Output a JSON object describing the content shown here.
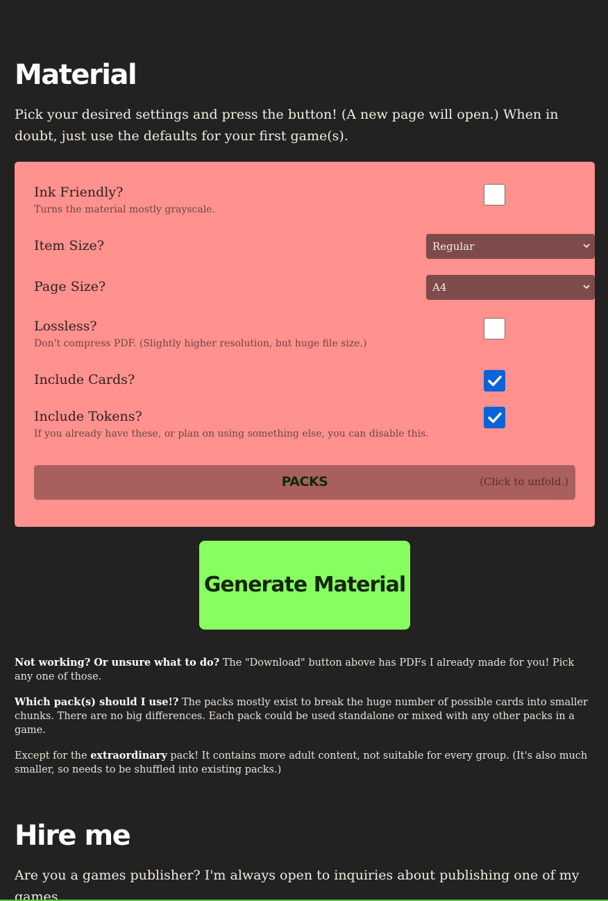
{
  "material": {
    "title": "Material",
    "intro": "Pick your desired settings and press the button! (A new page will open.) When in doubt, just use the defaults for your first game(s)."
  },
  "settings": {
    "ink_friendly": {
      "label": "Ink Friendly?",
      "desc": "Turns the material mostly grayscale.",
      "checked": false
    },
    "item_size": {
      "label": "Item Size?",
      "value": "Regular"
    },
    "page_size": {
      "label": "Page Size?",
      "value": "A4"
    },
    "lossless": {
      "label": "Lossless?",
      "desc": "Don't compress PDF. (Slightly higher resolution, but huge file size.)",
      "checked": false
    },
    "include_cards": {
      "label": "Include Cards?",
      "checked": true
    },
    "include_tokens": {
      "label": "Include Tokens?",
      "desc": "If you already have these, or plan on using something else, you can disable this.",
      "checked": true
    }
  },
  "packs": {
    "title": "PACKS",
    "hint": "(Click to unfold.)"
  },
  "generate_button": "Generate Material",
  "notes": {
    "p1_bold": "Not working? Or unsure what to do?",
    "p1_text": " The \"Download\" button above has PDFs I already made for you! Pick any one of those.",
    "p2_bold": "Which pack(s) should I use!?",
    "p2_text": " The packs mostly exist to break the huge number of possible cards into smaller chunks. There are no big differences. Each pack could be used standalone or mixed with any other packs in a game.",
    "p3_before": "Except for the ",
    "p3_bold": "extraordinary",
    "p3_after": " pack! It contains more adult content, not suitable for every group. (It's also much smaller, so needs to be shuffled into existing packs.)"
  },
  "hire": {
    "title": "Hire me",
    "text": "Are you a games publisher? I'm always open to inquiries about publishing one of my games."
  },
  "colors": {
    "background": "#222222",
    "panel": "#ff918e",
    "select": "#7d4b49",
    "checkbox_checked": "#0a63d8",
    "generate_button": "#88ff61",
    "packs_bar": "#a85f5d"
  }
}
